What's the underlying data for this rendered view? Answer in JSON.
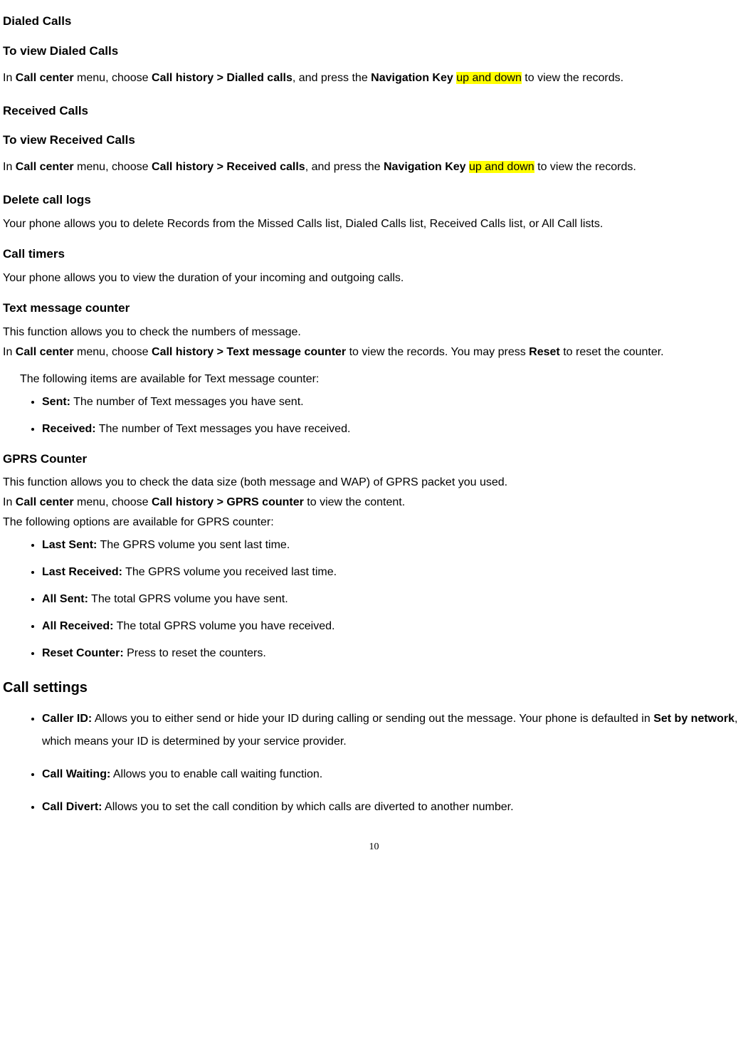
{
  "sections": {
    "dialed": {
      "title": "Dialed Calls",
      "subtitle": "To view Dialed Calls",
      "para_prefix": "In ",
      "b1": "Call center",
      "t1": " menu, choose ",
      "b2": "Call history > Dialled calls",
      "t2": ", and press the ",
      "b3": "Navigation Key",
      "t3": " ",
      "hl": "up and down",
      "t4": " to view the records."
    },
    "received": {
      "title": "Received Calls",
      "subtitle": "To view Received Calls",
      "para_prefix": "In ",
      "b1": "Call center",
      "t1": " menu, choose ",
      "b2": "Call history > Received calls",
      "t2": ", and press the ",
      "b3": "Navigation Key",
      "t3": " ",
      "hl": "up and down",
      "t4": " to view the records."
    },
    "delete": {
      "title": "Delete call logs",
      "body": "Your phone allows you to delete Records from the Missed Calls list, Dialed Calls list, Received Calls list, or All Call lists."
    },
    "timers": {
      "title": "Call timers",
      "body": "Your phone allows you to view the duration of your incoming and outgoing calls."
    },
    "textcounter": {
      "title": "Text message counter",
      "line1": "This function allows you to check the numbers of message.",
      "line2_prefix": "In ",
      "b1": "Call center",
      "t1": " menu, choose ",
      "b2": "Call history > Text message counter",
      "t2": " to view the records. You may press ",
      "b3": "Reset",
      "t3": " to reset the counter.",
      "intro": "The following items are available for Text message counter:",
      "items": [
        {
          "label": "Sent:",
          "desc": " The number of Text messages you have sent."
        },
        {
          "label": "Received:",
          "desc": " The number of Text messages you have received."
        }
      ]
    },
    "gprs": {
      "title": "GPRS Counter",
      "line1": "This function allows you to check the data size (both message and WAP) of GPRS packet you used.",
      "line2_prefix": "In ",
      "b1": "Call center",
      "t1": " menu, choose ",
      "b2": "Call history > GPRS counter",
      "t2": " to view the content.",
      "line3": "The following options are available for GPRS counter:",
      "items": [
        {
          "label": "Last Sent:",
          "desc": " The GPRS volume you sent last time."
        },
        {
          "label": "Last Received:",
          "desc": " The GPRS volume you received last time."
        },
        {
          "label": "All Sent:",
          "desc": " The total GPRS volume you have sent."
        },
        {
          "label": "All Received:",
          "desc": " The total GPRS volume you have received."
        },
        {
          "label": "Reset Counter:",
          "desc": " Press to reset the counters."
        }
      ]
    },
    "callsettings": {
      "title": "Call settings",
      "items": [
        {
          "label": "Caller ID:",
          "desc1": " Allows you to either send or hide your ID during calling or sending out the message. Your phone is defaulted in ",
          "b1": "Set by network",
          "desc2": ", which means your ID is determined by your service provider."
        },
        {
          "label": "Call Waiting:",
          "desc1": " Allows you to enable call waiting function.",
          "b1": "",
          "desc2": ""
        },
        {
          "label": "Call Divert:",
          "desc1": " Allows you to set the call condition by which calls are diverted to another number.",
          "b1": "",
          "desc2": ""
        }
      ]
    }
  },
  "page_number": "10"
}
